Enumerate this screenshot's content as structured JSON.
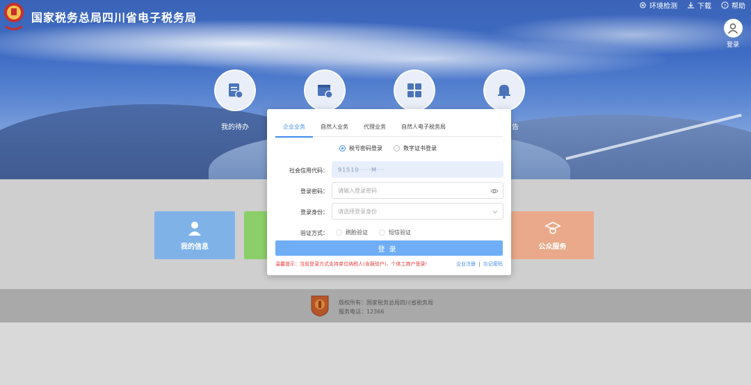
{
  "header": {
    "site_title": "国家税务总局四川省电子税务局",
    "links": [
      {
        "label": "环境检测",
        "icon": "settings-icon"
      },
      {
        "label": "下载",
        "icon": "download-icon"
      },
      {
        "label": "帮助",
        "icon": "help-icon"
      }
    ],
    "user_login": "登录"
  },
  "hero_icons": [
    {
      "label": "我的待办",
      "icon": "todo-icon"
    },
    {
      "label": "",
      "icon": "calendar-icon"
    },
    {
      "label": "",
      "icon": "grid-icon"
    },
    {
      "label": "告",
      "icon": "bell-icon"
    }
  ],
  "tiles": [
    {
      "label": "我的信息",
      "icon": "person-icon",
      "color": "#7fb3e8"
    },
    {
      "label": "",
      "icon": "",
      "color": "#8ccf6a"
    },
    {
      "label": "公众服务",
      "icon": "graduate-icon",
      "color": "#e9a98a"
    }
  ],
  "footer": {
    "copyright": "版权所有：国家税务总局四川省税务局",
    "hotline": "服务电话：12366"
  },
  "login": {
    "tabs": [
      "企业业务",
      "自然人业务",
      "代理业务",
      "自然人电子税务局"
    ],
    "active_tab": "企业业务",
    "methods": [
      "税号密码登录",
      "数字证书登录"
    ],
    "selected_method": "税号密码登录",
    "credit_code_label": "社会信用代码：",
    "credit_code_value": "91510·····M···",
    "password_label": "登录密码：",
    "password_placeholder": "请输入登录密码",
    "identity_label": "登录身份：",
    "identity_placeholder": "请选择登录身份",
    "verify_label": "验证方式：",
    "verify_options": [
      "刷脸验证",
      "短信验证"
    ],
    "login_button": "登录",
    "tip": "温馨提示：当前登录方式支持单位纳税人(含报验户)、个体工商户登录!",
    "register_link": "企业注册",
    "separator": "|",
    "forgot_link": "忘记密码"
  },
  "colors": {
    "accent": "#3e8cf0",
    "button": "#6faef6",
    "tip_red": "#e53b3b"
  }
}
